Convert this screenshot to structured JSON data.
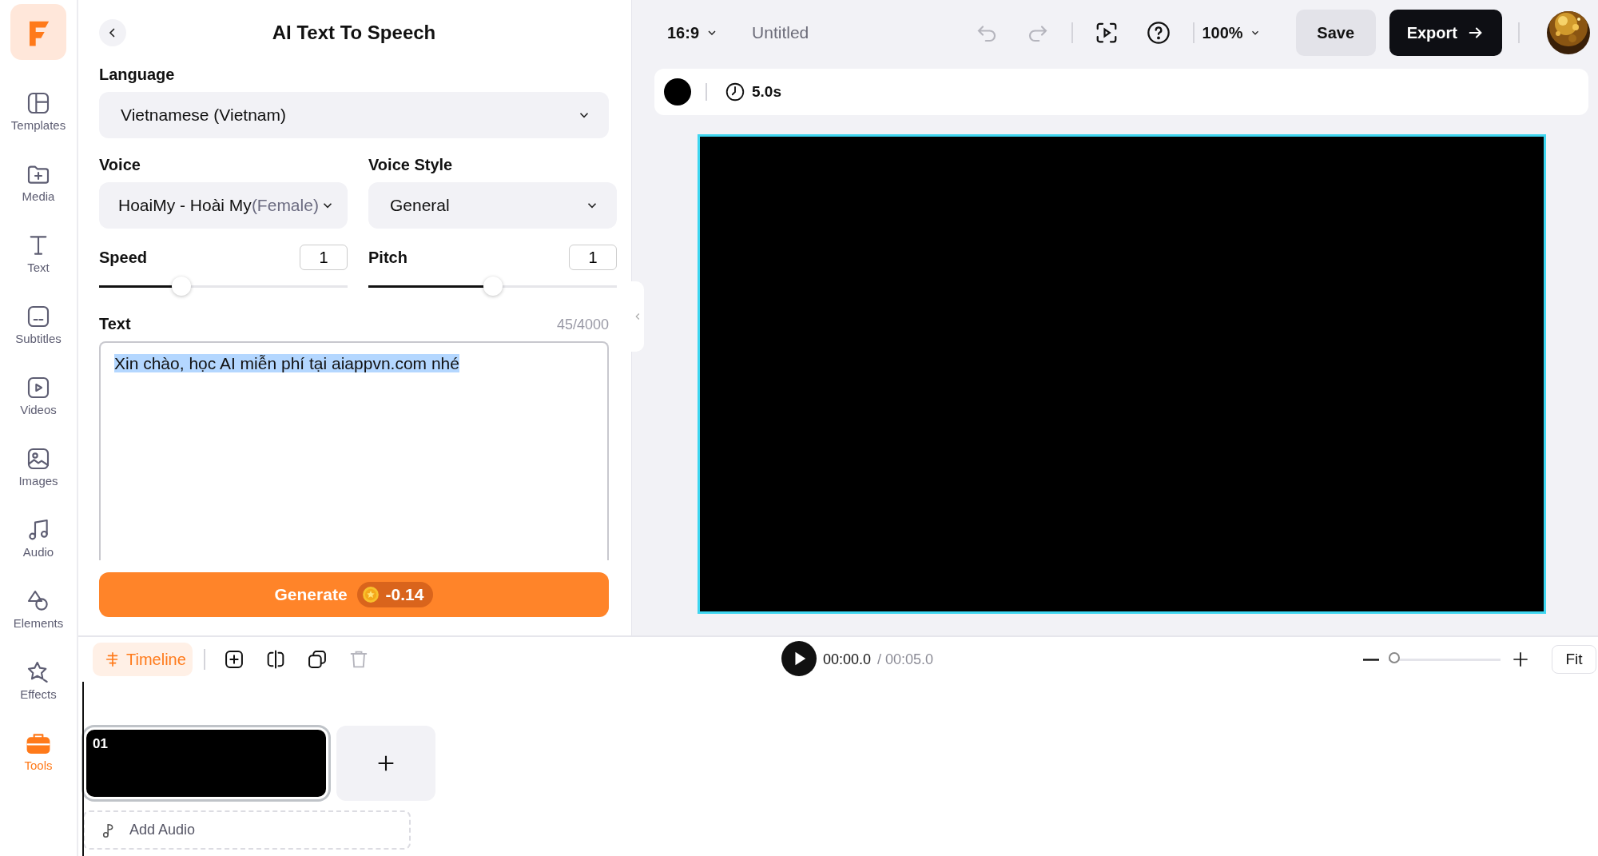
{
  "sidebar": {
    "items": [
      {
        "label": "Templates",
        "selected": false
      },
      {
        "label": "Media",
        "selected": false
      },
      {
        "label": "Text",
        "selected": false
      },
      {
        "label": "Subtitles",
        "selected": false
      },
      {
        "label": "Videos",
        "selected": false
      },
      {
        "label": "Images",
        "selected": false
      },
      {
        "label": "Audio",
        "selected": false
      },
      {
        "label": "Elements",
        "selected": false
      },
      {
        "label": "Effects",
        "selected": false
      },
      {
        "label": "Tools",
        "selected": true
      }
    ]
  },
  "panel": {
    "title": "AI Text To Speech",
    "language": {
      "label": "Language",
      "value": "Vietnamese (Vietnam)"
    },
    "voice": {
      "label": "Voice",
      "value": "HoaiMy - Hoài My",
      "note": "(Female)"
    },
    "voice_style": {
      "label": "Voice Style",
      "value": "General"
    },
    "sliders": [
      {
        "label": "Speed",
        "value": "1",
        "level": 0.33
      },
      {
        "label": "Pitch",
        "value": "1",
        "level": 0.5
      }
    ],
    "text": {
      "label": "Text",
      "count": "45/4000",
      "value": "Xin chào, học AI miễn phí tại aiappvn.com nhé",
      "selected": true
    },
    "generate": {
      "label": "Generate",
      "cost": "-0.14"
    }
  },
  "toolbar": {
    "aspect": "16:9",
    "title": "Untitled",
    "undo": {
      "disabled": true
    },
    "redo": {
      "disabled": true
    },
    "zoom": "100%",
    "save": "Save",
    "export": "Export"
  },
  "scene_bar": {
    "duration": "5.0s"
  },
  "timeline": {
    "tab": "Timeline",
    "delete": {
      "disabled": true
    },
    "current_time": "00:00.0",
    "total_time": "/ 00:05.0",
    "zoom_slider": {
      "level": 0.05
    },
    "fit": "Fit",
    "clips": [
      {
        "label": "01",
        "selected": true
      }
    ],
    "add_audio": "Add Audio"
  }
}
